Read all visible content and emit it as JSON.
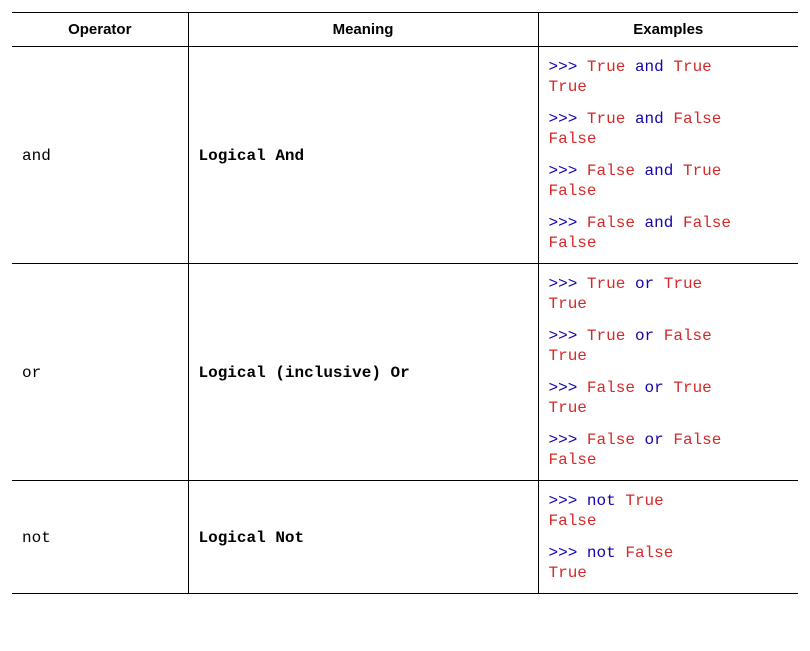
{
  "headers": [
    "Operator",
    "Meaning",
    "Examples"
  ],
  "prompt": ">>>",
  "rows": [
    {
      "operator": "and",
      "meaning": "Logical And",
      "examples": [
        {
          "operands": [
            "True",
            "True"
          ],
          "keyword": "and",
          "output": "True"
        },
        {
          "operands": [
            "True",
            "False"
          ],
          "keyword": "and",
          "output": "False"
        },
        {
          "operands": [
            "False",
            "True"
          ],
          "keyword": "and",
          "output": "False"
        },
        {
          "operands": [
            "False",
            "False"
          ],
          "keyword": "and",
          "output": "False"
        }
      ]
    },
    {
      "operator": "or",
      "meaning": "Logical (inclusive) Or",
      "examples": [
        {
          "operands": [
            "True",
            "True"
          ],
          "keyword": "or",
          "output": "True"
        },
        {
          "operands": [
            "True",
            "False"
          ],
          "keyword": "or",
          "output": "True"
        },
        {
          "operands": [
            "False",
            "True"
          ],
          "keyword": "or",
          "output": "True"
        },
        {
          "operands": [
            "False",
            "False"
          ],
          "keyword": "or",
          "output": "False"
        }
      ]
    },
    {
      "operator": "not",
      "meaning": "Logical Not",
      "examples": [
        {
          "operands": [
            "True"
          ],
          "keyword": "not",
          "output": "False"
        },
        {
          "operands": [
            "False"
          ],
          "keyword": "not",
          "output": "True"
        }
      ]
    }
  ]
}
